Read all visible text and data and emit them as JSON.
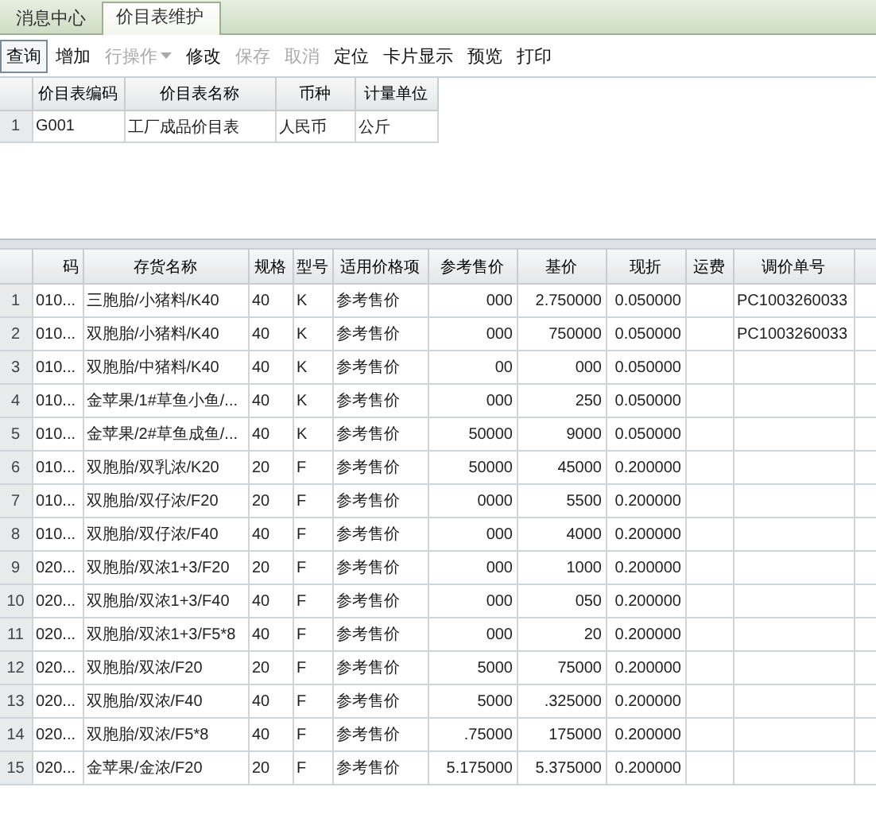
{
  "tabs": [
    {
      "label": "消息中心",
      "selected": false
    },
    {
      "label": "价目表维护",
      "selected": true
    }
  ],
  "toolbar": [
    {
      "label": "查询",
      "disabled": false,
      "focused": true
    },
    {
      "label": "增加",
      "disabled": false,
      "focused": false
    },
    {
      "label": "行操作",
      "disabled": true,
      "focused": false,
      "dropdown": true
    },
    {
      "label": "修改",
      "disabled": false,
      "focused": false
    },
    {
      "label": "保存",
      "disabled": true,
      "focused": false
    },
    {
      "label": "取消",
      "disabled": true,
      "focused": false
    },
    {
      "label": "定位",
      "disabled": false,
      "focused": false
    },
    {
      "label": "卡片显示",
      "disabled": false,
      "focused": false
    },
    {
      "label": "预览",
      "disabled": false,
      "focused": false
    },
    {
      "label": "打印",
      "disabled": false,
      "focused": false
    }
  ],
  "price_list_table": {
    "columns": [
      "价目表编码",
      "价目表名称",
      "币种",
      "计量单位"
    ],
    "rows": [
      {
        "number": "1",
        "cells": [
          "G001",
          "工厂成品价目表",
          "人民币",
          "公斤"
        ]
      }
    ]
  },
  "detail_table": {
    "columns": [
      "码",
      "存货名称",
      "规格",
      "型号",
      "适用价格项",
      "参考售价",
      "基价",
      "现折",
      "运费",
      "调价单号"
    ],
    "rows": [
      {
        "number": "1",
        "cells": [
          "010...",
          "三胞胎/小猪料/K40",
          "40",
          "K",
          "参考售价",
          "000",
          "2.750000",
          "0.050000",
          "",
          "PC1003260033"
        ]
      },
      {
        "number": "2",
        "cells": [
          "010...",
          "双胞胎/小猪料/K40",
          "40",
          "K",
          "参考售价",
          "000",
          "750000",
          "0.050000",
          "",
          "PC1003260033"
        ]
      },
      {
        "number": "3",
        "cells": [
          "010...",
          "双胞胎/中猪料/K40",
          "40",
          "K",
          "参考售价",
          "00",
          "000",
          "0.050000",
          "",
          ""
        ]
      },
      {
        "number": "4",
        "cells": [
          "010...",
          "金苹果/1#草鱼小鱼/...",
          "40",
          "K",
          "参考售价",
          "000",
          "250",
          "0.050000",
          "",
          ""
        ]
      },
      {
        "number": "5",
        "cells": [
          "010...",
          "金苹果/2#草鱼成鱼/...",
          "40",
          "K",
          "参考售价",
          "50000",
          "9000",
          "0.050000",
          "",
          ""
        ]
      },
      {
        "number": "6",
        "cells": [
          "010...",
          "双胞胎/双乳浓/K20",
          "20",
          "F",
          "参考售价",
          "50000",
          "45000",
          "0.200000",
          "",
          ""
        ]
      },
      {
        "number": "7",
        "cells": [
          "010...",
          "双胞胎/双仔浓/F20",
          "20",
          "F",
          "参考售价",
          "0000",
          "5500",
          "0.200000",
          "",
          ""
        ]
      },
      {
        "number": "8",
        "cells": [
          "010...",
          "双胞胎/双仔浓/F40",
          "40",
          "F",
          "参考售价",
          "000",
          "4000",
          "0.200000",
          "",
          ""
        ]
      },
      {
        "number": "9",
        "cells": [
          "020...",
          "双胞胎/双浓1+3/F20",
          "20",
          "F",
          "参考售价",
          "000",
          "1000",
          "0.200000",
          "",
          ""
        ]
      },
      {
        "number": "10",
        "cells": [
          "020...",
          "双胞胎/双浓1+3/F40",
          "40",
          "F",
          "参考售价",
          "000",
          "050",
          "0.200000",
          "",
          ""
        ]
      },
      {
        "number": "11",
        "cells": [
          "020...",
          "双胞胎/双浓1+3/F5*8",
          "40",
          "F",
          "参考售价",
          "000",
          "20",
          "0.200000",
          "",
          ""
        ]
      },
      {
        "number": "12",
        "cells": [
          "020...",
          "双胞胎/双浓/F20",
          "20",
          "F",
          "参考售价",
          "5000",
          "75000",
          "0.200000",
          "",
          ""
        ]
      },
      {
        "number": "13",
        "cells": [
          "020...",
          "双胞胎/双浓/F40",
          "40",
          "F",
          "参考售价",
          "5000",
          ".325000",
          "0.200000",
          "",
          ""
        ]
      },
      {
        "number": "14",
        "cells": [
          "020...",
          "双胞胎/双浓/F5*8",
          "40",
          "F",
          "参考售价",
          ".75000",
          "175000",
          "0.200000",
          "",
          ""
        ]
      },
      {
        "number": "15",
        "cells": [
          "020...",
          "金苹果/金浓/F20",
          "20",
          "F",
          "参考售价",
          "5.175000",
          "5.375000",
          "0.200000",
          "",
          ""
        ]
      }
    ]
  }
}
